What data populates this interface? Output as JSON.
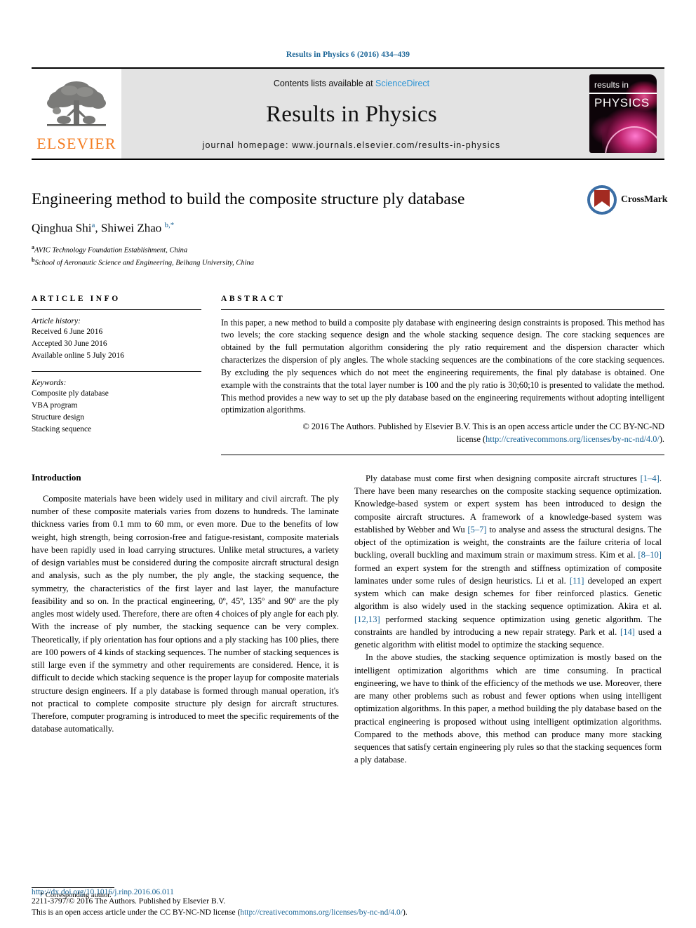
{
  "running_head": "Results in Physics 6 (2016) 434–439",
  "masthead": {
    "publisher_logo_label": "ELSEVIER",
    "contents_prefix": "Contents lists available at ",
    "contents_link": "ScienceDirect",
    "journal_title": "Results in Physics",
    "homepage": "journal homepage: www.journals.elsevier.com/results-in-physics",
    "cover": {
      "line1": "results in",
      "line2": "PHYSICS"
    }
  },
  "article": {
    "title": "Engineering method to build the composite structure ply database",
    "authors": [
      {
        "name": "Qinghua Shi",
        "marker": "a"
      },
      {
        "name": "Shiwei Zhao",
        "marker": "b,*"
      }
    ],
    "authors_plain": "Qinghua Shi a, Shiwei Zhao b,*",
    "affiliations": [
      {
        "marker": "a",
        "text": "AVIC Technology Foundation Establishment, China"
      },
      {
        "marker": "b",
        "text": "School of Aeronautic Science and Engineering, Beihang University, China"
      }
    ],
    "crossmark_label": "CrossMark"
  },
  "article_info": {
    "heading": "ARTICLE INFO",
    "history_label": "Article history:",
    "history": [
      "Received 6 June 2016",
      "Accepted 30 June 2016",
      "Available online 5 July 2016"
    ],
    "keywords_label": "Keywords:",
    "keywords": [
      "Composite ply database",
      "VBA program",
      "Structure design",
      "Stacking sequence"
    ]
  },
  "abstract": {
    "heading": "ABSTRACT",
    "text": "In this paper, a new method to build a composite ply database with engineering design constraints is proposed. This method has two levels; the core stacking sequence design and the whole stacking sequence design. The core stacking sequences are obtained by the full permutation algorithm considering the ply ratio requirement and the dispersion character which characterizes the dispersion of ply angles. The whole stacking sequences are the combinations of the core stacking sequences. By excluding the ply sequences which do not meet the engineering requirements, the final ply database is obtained. One example with the constraints that the total layer number is 100 and the ply ratio is 30;60;10 is presented to validate the method. This method provides a new way to set up the ply database based on the engineering requirements without adopting intelligent optimization algorithms.",
    "copyright_line1": "© 2016 The Authors. Published by Elsevier B.V. This is an open access article under the CC BY-NC-ND",
    "copyright_line2_prefix": "license (",
    "copyright_link": "http://creativecommons.org/licenses/by-nc-nd/4.0/",
    "copyright_line2_suffix": ")."
  },
  "body": {
    "section_heading": "Introduction",
    "left_paragraphs": [
      "Composite materials have been widely used in military and civil aircraft. The ply number of these composite materials varies from dozens to hundreds. The laminate thickness varies from 0.1 mm to 60 mm, or even more. Due to the benefits of low weight, high strength, being corrosion-free and fatigue-resistant, composite materials have been rapidly used in load carrying structures. Unlike metal structures, a variety of design variables must be considered during the composite aircraft structural design and analysis, such as the ply number, the ply angle, the stacking sequence, the symmetry, the characteristics of the first layer and last layer, the manufacture feasibility and so on. In the practical engineering, 0º, 45º, 135º and 90º are the ply angles most widely used. Therefore, there are often 4 choices of ply angle for each ply. With the increase of ply number, the stacking sequence can be very complex. Theoretically, if ply orientation has four options and a ply stacking has 100 plies, there are 100 powers of 4 kinds of stacking sequences. The number of stacking sequences is still large even if the symmetry and other requirements are considered. Hence, it is difficult to decide which stacking sequence is the proper layup for composite materials structure design engineers. If a ply database is formed through manual operation, it's not practical to complete composite structure ply design for aircraft structures. Therefore, computer programing is introduced to meet the specific requirements of the database automatically."
    ],
    "right_paragraph_1": {
      "segments": [
        {
          "type": "text",
          "value": "Ply database must come first when designing composite aircraft structures "
        },
        {
          "type": "cite",
          "value": "[1–4]"
        },
        {
          "type": "text",
          "value": ". There have been many researches on the composite stacking sequence optimization. Knowledge-based system or expert system has been introduced to design the composite aircraft structures. A framework of a knowledge-based system was established by Webber and Wu "
        },
        {
          "type": "cite",
          "value": "[5–7]"
        },
        {
          "type": "text",
          "value": " to analyse and assess the structural designs. The object of the optimization is weight, the constraints are the failure criteria of local buckling, overall buckling and maximum strain or maximum stress. Kim et al. "
        },
        {
          "type": "cite",
          "value": "[8–10]"
        },
        {
          "type": "text",
          "value": " formed an expert system for the strength and stiffness optimization of composite laminates under some rules of design heuristics. Li et al. "
        },
        {
          "type": "cite",
          "value": "[11]"
        },
        {
          "type": "text",
          "value": " developed an expert system which can make design schemes for fiber reinforced plastics. Genetic algorithm is also widely used in the stacking sequence optimization. Akira et al. "
        },
        {
          "type": "cite",
          "value": "[12,13]"
        },
        {
          "type": "text",
          "value": " performed stacking sequence optimization using genetic algorithm. The constraints are handled by introducing a new repair strategy. Park et al. "
        },
        {
          "type": "cite",
          "value": "[14]"
        },
        {
          "type": "text",
          "value": " used a genetic algorithm with elitist model to optimize the stacking sequence."
        }
      ]
    },
    "right_paragraph_2": "In the above studies, the stacking sequence optimization is mostly based on the intelligent optimization algorithms which are time consuming. In practical engineering, we have to think of the efficiency of the methods we use. Moreover, there are many other problems such as robust and fewer options when using intelligent optimization algorithms. In this paper, a method building the ply database based on the practical engineering is proposed without using intelligent optimization algorithms. Compared to the methods above, this method can produce many more stacking sequences that satisfy certain engineering ply rules so that the stacking sequences form a ply database."
  },
  "footnote": {
    "corresponding_author": "* Corresponding author."
  },
  "footer": {
    "doi": "http://dx.doi.org/10.1016/j.rinp.2016.06.011",
    "issn_line": "2211-3797/© 2016 The Authors. Published by Elsevier B.V.",
    "license_prefix": "This is an open access article under the CC BY-NC-ND license (",
    "license_link": "http://creativecommons.org/licenses/by-nc-nd/4.0/",
    "license_suffix": ")."
  },
  "colors": {
    "link_blue": "#1a6496",
    "sciencedirect_blue": "#2a93d5",
    "elsevier_orange": "#f47c20",
    "masthead_grey": "#e3e3e3"
  }
}
